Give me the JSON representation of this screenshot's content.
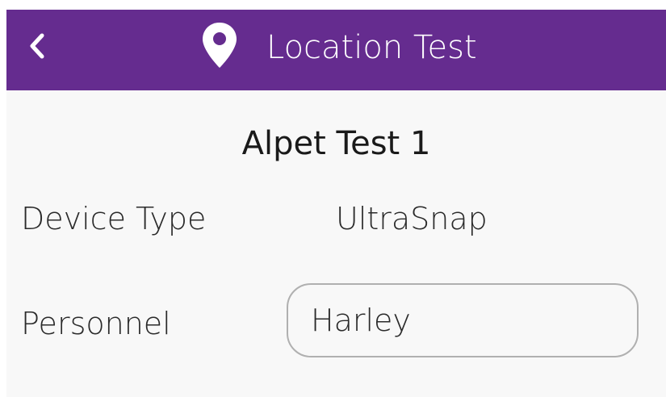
{
  "appbar": {
    "title": "Location Test",
    "background_color": "#652c8f",
    "back_icon": "chevron-left-icon",
    "title_icon": "location-pin-icon"
  },
  "record": {
    "title": "Alpet Test 1"
  },
  "fields": {
    "device_type": {
      "label": "Device Type",
      "value": "UltraSnap"
    },
    "personnel": {
      "label": "Personnel",
      "value": "Harley"
    }
  }
}
